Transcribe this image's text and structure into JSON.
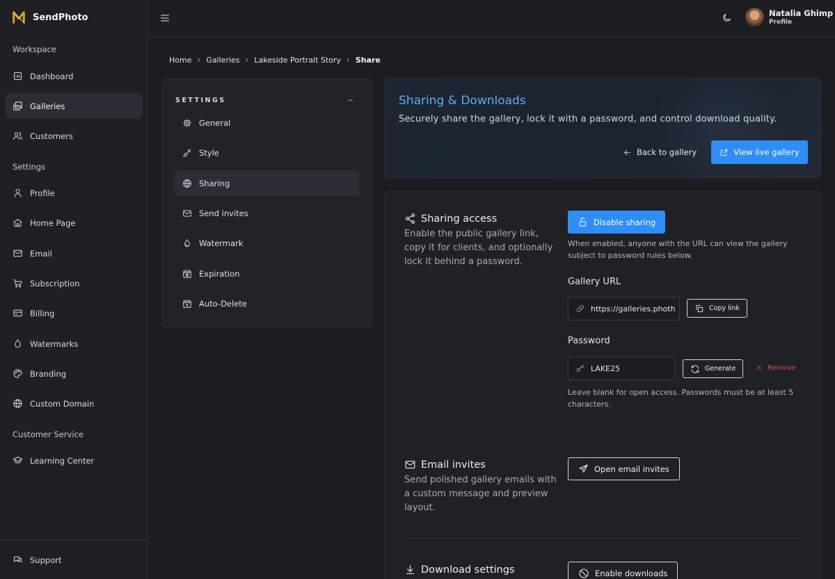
{
  "brand": {
    "name": "SendPhoto"
  },
  "sidebar": {
    "sections": {
      "workspace": "Workspace",
      "settings": "Settings",
      "customer_service": "Customer Service"
    },
    "items": [
      {
        "label": "Dashboard",
        "icon": "dashboard-icon"
      },
      {
        "label": "Galleries",
        "icon": "gallery-icon",
        "active": true
      },
      {
        "label": "Customers",
        "icon": "users-icon"
      },
      {
        "label": "Profile",
        "icon": "user-icon"
      },
      {
        "label": "Home Page",
        "icon": "home-icon"
      },
      {
        "label": "Email",
        "icon": "mail-icon"
      },
      {
        "label": "Subscription",
        "icon": "cart-icon"
      },
      {
        "label": "Billing",
        "icon": "credit-card-icon"
      },
      {
        "label": "Watermarks",
        "icon": "drop-icon"
      },
      {
        "label": "Branding",
        "icon": "palette-icon"
      },
      {
        "label": "Custom Domain",
        "icon": "globe-icon"
      },
      {
        "label": "Learning Center",
        "icon": "graduation-cap-icon"
      }
    ],
    "support": "Support"
  },
  "user": {
    "name": "Natalia Ghimp",
    "role": "Profile"
  },
  "breadcrumb": [
    "Home",
    "Galleries",
    "Lakeside Portrait Story",
    "Share"
  ],
  "settings_panel": {
    "heading": "SETTINGS",
    "items": [
      {
        "label": "General",
        "icon": "gear-icon"
      },
      {
        "label": "Style",
        "icon": "brush-icon"
      },
      {
        "label": "Sharing",
        "icon": "globe-icon",
        "active": true
      },
      {
        "label": "Send invites",
        "icon": "mail-icon"
      },
      {
        "label": "Watermark",
        "icon": "drop-icon"
      },
      {
        "label": "Expiration",
        "icon": "calendar-clock-icon"
      },
      {
        "label": "Auto-Delete",
        "icon": "calendar-x-icon"
      }
    ]
  },
  "hero": {
    "title": "Sharing & Downloads",
    "subtitle": "Securely share the gallery, lock it with a password, and control download quality.",
    "back_label": "Back to gallery",
    "view_live_label": "View live gallery"
  },
  "sharing": {
    "title": "Sharing access",
    "description": "Enable the public gallery link, copy it for clients, and optionally lock it behind a password.",
    "toggle_label": "Disable sharing",
    "toggle_help": "When enabled, anyone with the URL can view the gallery subject to password rules below.",
    "url_label": "Gallery URL",
    "url_value": "https://galleries.photh",
    "copy_label": "Copy link",
    "password_label": "Password",
    "password_value": "LAKE25",
    "generate_label": "Generate",
    "remove_label": "Remove",
    "password_help": "Leave blank for open access. Passwords must be at least 5 characters."
  },
  "email_invites": {
    "title": "Email invites",
    "description": "Send polished gallery emails with a custom message and preview layout.",
    "button_label": "Open email invites"
  },
  "downloads": {
    "title": "Download settings",
    "button_label": "Enable downloads"
  },
  "colors": {
    "accent": "#2f8df5",
    "title_blue": "#5aaef5",
    "danger": "#e0484a",
    "background": "#1b1d22"
  }
}
